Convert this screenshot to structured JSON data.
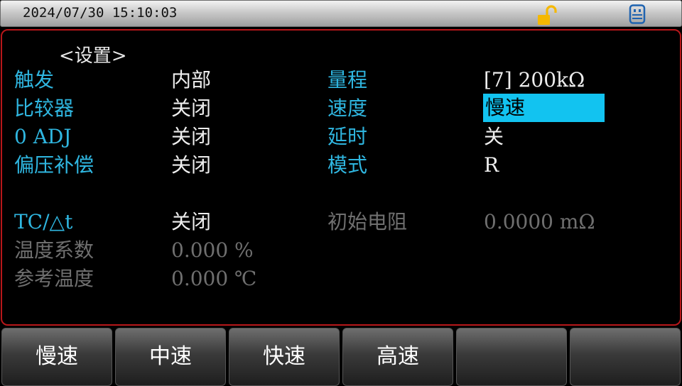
{
  "status_bar": {
    "datetime": "2024/07/30  15:10:03",
    "icons": [
      "unlocked-padlock-icon",
      "usb-icon"
    ],
    "icon_colors": {
      "lock": "#f5b800",
      "usb": "#1f63b0"
    }
  },
  "screen": {
    "title": "<设置>",
    "rows": [
      {
        "label1": "触发",
        "value1": "内部",
        "label2": "量程",
        "value2": "[7] 200kΩ"
      },
      {
        "label1": "比较器",
        "value1": "关闭",
        "label2": "速度",
        "value2": "慢速"
      },
      {
        "label1": "0 ADJ",
        "value1": "关闭",
        "label2": "延时",
        "value2": "关"
      },
      {
        "label1": "偏压补偿",
        "value1": "关闭",
        "label2": "模式",
        "value2": "R"
      }
    ],
    "tc": {
      "label": "TC/△t",
      "value": "关闭",
      "initial_resistance_label": "初始电阻",
      "initial_resistance_value": "0.0000 mΩ",
      "temp_coeff_label": "温度系数",
      "temp_coeff_value": "0.000 %",
      "ref_temp_label": "参考温度",
      "ref_temp_value": "0.000 ℃"
    },
    "colors": {
      "label": "#2fb6e0",
      "value": "#ededed",
      "disabled": "#6f6f6f",
      "selection": "#12c3f0",
      "frame_border": "#b8171a"
    }
  },
  "softkeys": [
    "慢速",
    "中速",
    "快速",
    "高速",
    "",
    ""
  ]
}
